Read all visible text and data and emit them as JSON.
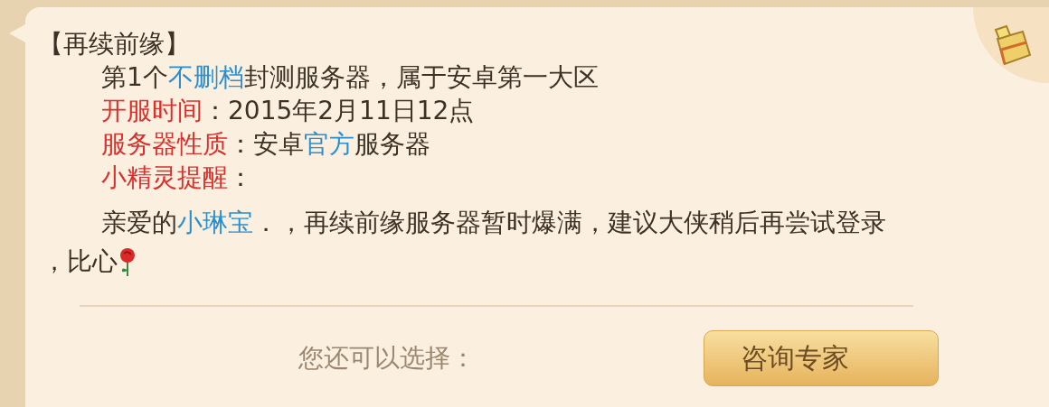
{
  "title": "【再续前缘】",
  "lines": [
    {
      "kind": "indented",
      "segments": [
        {
          "text": "第1个",
          "kind": "plain"
        },
        {
          "text": "不删档",
          "kind": "link"
        },
        {
          "text": "封测服务器，属于安卓第一大区",
          "kind": "plain"
        }
      ]
    },
    {
      "kind": "indented",
      "segments": [
        {
          "text": "开服时间",
          "kind": "label"
        },
        {
          "text": "：2015年2月11日12点",
          "kind": "plain"
        }
      ]
    },
    {
      "kind": "indented",
      "segments": [
        {
          "text": "服务器性质",
          "kind": "label"
        },
        {
          "text": "：安卓",
          "kind": "plain"
        },
        {
          "text": "官方",
          "kind": "link"
        },
        {
          "text": "服务器",
          "kind": "plain"
        }
      ]
    },
    {
      "kind": "indented",
      "segments": [
        {
          "text": "小精灵提醒",
          "kind": "label"
        },
        {
          "text": "：",
          "kind": "plain"
        }
      ]
    },
    {
      "kind": "indented",
      "gap": true,
      "segments": [
        {
          "text": "亲爱的",
          "kind": "plain"
        },
        {
          "text": "小琳宝",
          "kind": "link"
        },
        {
          "text": "．，再续前缘服务器暂时爆满，建议大侠稍后再尝试登录",
          "kind": "plain"
        }
      ]
    },
    {
      "kind": "outdented",
      "rose": true,
      "segments": [
        {
          "text": "，比心",
          "kind": "plain"
        }
      ]
    }
  ],
  "footer": {
    "prompt": "您还可以选择：",
    "button": "咨询专家"
  }
}
